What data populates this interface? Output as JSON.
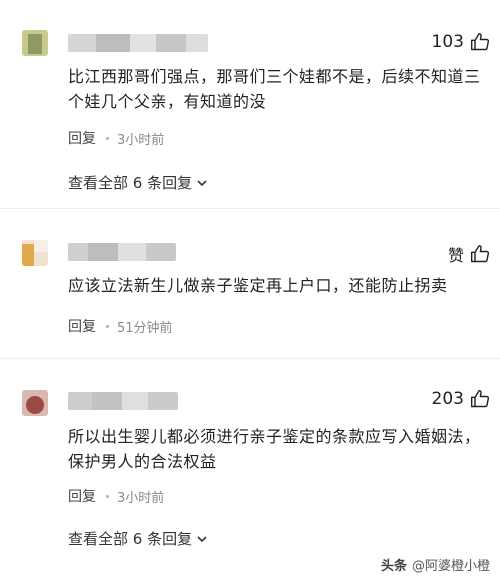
{
  "comments": [
    {
      "like_count": "103",
      "text": "比江西那哥们强点，那哥们三个娃都不是，后续不知道三个娃几个父亲，有知道的没",
      "reply_label": "回复",
      "time": "3小时前",
      "view_replies": "查看全部 6 条回复"
    },
    {
      "like_label": "赞",
      "text": "应该立法新生儿做亲子鉴定再上户口，还能防止拐卖",
      "reply_label": "回复",
      "time": "51分钟前"
    },
    {
      "like_count": "203",
      "text": "所以出生婴儿都必须进行亲子鉴定的条款应写入婚姻法，保护男人的合法权益",
      "reply_label": "回复",
      "time": "3小时前",
      "view_replies": "查看全部 6 条回复"
    }
  ],
  "watermark": {
    "logo": "头条",
    "author": "@阿婆橙小橙"
  },
  "colors": {
    "text": "#222222",
    "meta": "#8a8a8a",
    "divider": "#eeeeee"
  }
}
